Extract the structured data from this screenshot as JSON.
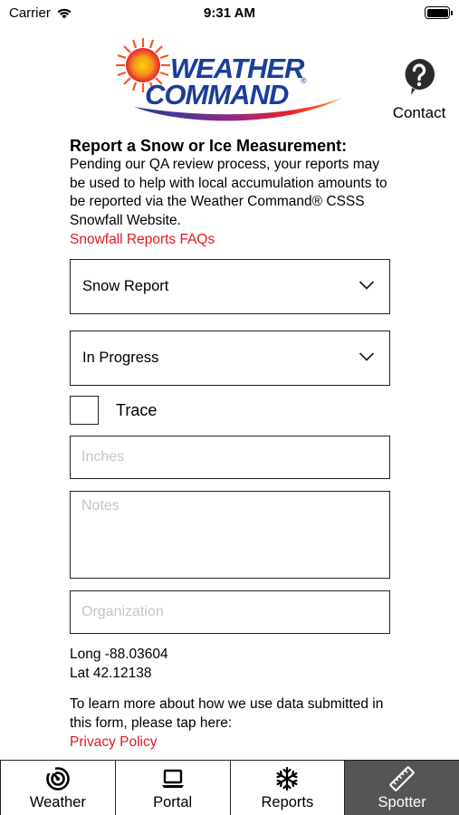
{
  "status_bar": {
    "carrier": "Carrier",
    "time": "9:31 AM"
  },
  "header": {
    "logo_line1": "WEATHER",
    "logo_line2": "COMMAND",
    "logo_reg": "®",
    "contact_label": "Contact"
  },
  "intro": {
    "title": "Report a Snow or Ice Measurement:",
    "body": "Pending our QA review process, your reports may be used to help with local accumulation amounts to be reported via the Weather Command® CSSS Snowfall Website.",
    "faq_link": "Snowfall Reports FAQs"
  },
  "form": {
    "report_type": "Snow Report",
    "status": "In Progress",
    "trace_label": "Trace",
    "inches_placeholder": "Inches",
    "notes_placeholder": "Notes",
    "organization_placeholder": "Organization"
  },
  "location": {
    "long": "Long -88.03604",
    "lat": "Lat 42.12138"
  },
  "privacy": {
    "text": "To learn more about how we use data submitted in this form, please tap here:",
    "link": "Privacy Policy"
  },
  "tabs": [
    {
      "label": "Weather",
      "icon": "radar-icon"
    },
    {
      "label": "Portal",
      "icon": "laptop-icon"
    },
    {
      "label": "Reports",
      "icon": "snowflake-icon"
    },
    {
      "label": "Spotter",
      "icon": "ruler-icon",
      "active": true
    }
  ],
  "colors": {
    "link": "#e0181f",
    "logo_blue": "#1b3e9a",
    "active_tab": "#555555"
  }
}
